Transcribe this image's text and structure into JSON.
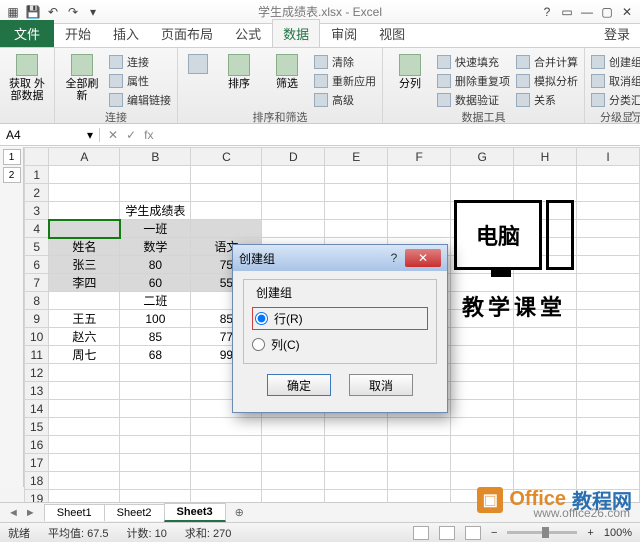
{
  "window": {
    "title": "学生成绩表.xlsx - Excel"
  },
  "tabs": {
    "file": "文件",
    "list": [
      "开始",
      "插入",
      "页面布局",
      "公式",
      "数据",
      "审阅",
      "视图"
    ],
    "active": "数据",
    "login": "登录"
  },
  "ribbon": {
    "group1": {
      "big1": "获取\n外部数据",
      "label": ""
    },
    "group2": {
      "big1": "全部刷新",
      "s1": "连接",
      "s2": "属性",
      "s3": "编辑链接",
      "label": "连接"
    },
    "group3": {
      "big1": "排序",
      "big2": "筛选",
      "s1": "清除",
      "s2": "重新应用",
      "s3": "高级",
      "label": "排序和筛选"
    },
    "group4": {
      "big1": "分列",
      "s1": "快速填充",
      "s2": "删除重复项",
      "s3": "数据验证",
      "s4": "合并计算",
      "s5": "模拟分析",
      "s6": "关系",
      "label": "数据工具"
    },
    "group5": {
      "s1": "创建组",
      "s2": "取消组合",
      "s3": "分类汇总",
      "label": "分级显示"
    }
  },
  "namebox": "A4",
  "fx": "fx",
  "outline": [
    "1",
    "2"
  ],
  "columns": [
    "A",
    "B",
    "C",
    "D",
    "E",
    "F",
    "G",
    "H",
    "I"
  ],
  "rows": [
    "1",
    "2",
    "3",
    "4",
    "5",
    "6",
    "7",
    "8",
    "9",
    "10",
    "11",
    "12",
    "13",
    "14",
    "15",
    "16",
    "17",
    "18",
    "19"
  ],
  "cells": {
    "B3": "学生成绩表",
    "B4": "一班",
    "A5": "姓名",
    "B5": "数学",
    "C5": "语文",
    "A6": "张三",
    "B6": "80",
    "C6": "75",
    "A7": "李四",
    "B7": "60",
    "C7": "55",
    "B8": "二班",
    "A9": "王五",
    "B9": "100",
    "C9": "85",
    "A10": "赵六",
    "B10": "85",
    "C10": "77",
    "A11": "周七",
    "B11": "68",
    "C11": "99"
  },
  "graphic": {
    "inside": "电脑",
    "below": "教学课堂"
  },
  "dialog": {
    "title": "创建组",
    "legend": "创建组",
    "opt_row": "行(R)",
    "opt_col": "列(C)",
    "ok": "确定",
    "cancel": "取消"
  },
  "sheets": {
    "nav": [
      "◄",
      "►"
    ],
    "list": [
      "Sheet1",
      "Sheet2",
      "Sheet3"
    ],
    "active": "Sheet3",
    "add": "⊕"
  },
  "status": {
    "ready": "就绪",
    "avg_l": "平均值:",
    "avg_v": "67.5",
    "cnt_l": "计数:",
    "cnt_v": "10",
    "sum_l": "求和:",
    "sum_v": "270",
    "zoom": "100%"
  },
  "watermark": {
    "brand1": "Office",
    "brand2": "教程网",
    "url": "www.office26.com"
  }
}
